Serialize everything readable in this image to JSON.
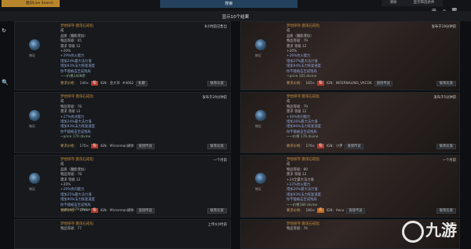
{
  "topbar": {
    "live_label": "图识Live Search",
    "search_label": "搜索",
    "clear_label": "清除",
    "filter_label": "显示筛选条件"
  },
  "results": {
    "count_label": "显示10个结果"
  },
  "cards": [
    {
      "name": "梦想掠夺  震荡石戒指",
      "type": "戒",
      "lines": [
        "品质（魔能增加）",
        "物品等级：65",
        "需求 等级 12"
      ],
      "implicit": "+20%",
      "mods": [
        "+29%抗火能力",
        "增加24%最大法力值",
        "增加93%法力恢复速度",
        "你不能被击至成残局"
      ],
      "note": "~一价格1408崇",
      "time": "8小时前已售出",
      "thumb_label": "物证",
      "price_label": "要求价格：",
      "price": "140×",
      "badge": "仙",
      "ign": "IGN:",
      "seller": "金大吊",
      "tag": "#4662",
      "whisper": "私聊",
      "contact": "联系玩家"
    },
    {
      "name": "梦想掠夺  震荡石戒指",
      "type": "戒",
      "lines": [
        "品质（魔能增加）",
        "物品等级：79",
        "需求 等级 12"
      ],
      "implicit": "+20%",
      "mods": [
        "+26%抗火能力",
        "增加27%最大法力值",
        "增加94%法力恢复速度",
        "你不能被击至成残局"
      ],
      "note": "~price 165 divine",
      "time": "发布于19分钟前",
      "thumb_label": "物证",
      "price_label": "要求价格：",
      "price": "165×",
      "badge": "仙",
      "ign": "IGN:",
      "seller": "INFERNALING_VACOK",
      "whisper": "直接传送",
      "contact": "联系玩家"
    },
    {
      "name": "梦想掠夺  震荡石戒指",
      "type": "戒",
      "lines": [
        "物品等级：78",
        "需求 等级 12"
      ],
      "implicit": "",
      "mods": [
        "+27%抗冰能力",
        "增加24%最大法力值",
        "增加93%法力恢复速度",
        "你不能被击至成残局"
      ],
      "note": "~price 170 divine",
      "time": "发布于29分钟前",
      "thumb_label": "物证",
      "price_label": "要求价格：",
      "price": "170×",
      "badge": "仙",
      "ign": "IGN:",
      "seller": "Mirrorman媒体",
      "whisper": "直接传送",
      "contact": "联系玩家"
    },
    {
      "name": "梦想掠夺  震荡石戒指",
      "type": "戒",
      "lines": [
        "物品等级：79",
        "需求 等级 12"
      ],
      "implicit": "",
      "mods": [
        "+30%抗闪能力",
        "增加26%最大法力值",
        "增加96%法力恢复速度",
        "你不能被击至成残局"
      ],
      "note": "~一价格 176 divine",
      "time": "发布于5分钟前",
      "thumb_label": "物证",
      "price_label": "要求价格：",
      "price": "176×",
      "badge": "仙",
      "ign": "IGN:",
      "seller": "小伊",
      "whisper": "直接传送",
      "contact": "联系玩家"
    },
    {
      "name": "梦想掠夺  震荡石戒指",
      "type": "戒",
      "lines": [
        "品质（魔能增加）",
        "物品等级：78",
        "需求 等级 12"
      ],
      "implicit": "+20%",
      "mods": [
        "+29%抗闪能力",
        "增加25%最大法力值",
        "增加90%法力恢复速度",
        "你不能被击至成残局"
      ],
      "note": "~price 179 divine",
      "time": "一个月前",
      "thumb_label": "物证",
      "price_label": "要求价格：",
      "price": "179×",
      "badge": "仙",
      "ign": "IGN:",
      "seller": "Mirrorman媒体",
      "whisper": "直接传送",
      "contact": "联系玩家"
    },
    {
      "name": "梦想掠夺  震荡石戒指",
      "type": "戒",
      "lines": [
        "物品等级：80",
        "需求 等级 12"
      ],
      "implicit": "+24全最大法力值",
      "mods": [
        "+22%抗火能力",
        "增加20%最大法力值",
        "增加93%法力恢复速度",
        "你不能被击至成残局"
      ],
      "note": "~一价格180 divine",
      "time": "一个月前",
      "thumb_label": "物证",
      "price_label": "要求价格：",
      "price": "180×",
      "badge": "元",
      "ign": "IGN:",
      "seller": "Aeco",
      "whisper": "直接传送",
      "contact": "联系玩家"
    }
  ],
  "bottom_cards": [
    {
      "name": "梦想掠夺  震荡石戒指",
      "line": "物品等级：77",
      "time": "上传4小时前"
    },
    {
      "name": "梦想掠夺  震荡石戒指",
      "line": "物品等级：76",
      "time": "一个月前"
    }
  ],
  "logo": {
    "text": "九游"
  }
}
